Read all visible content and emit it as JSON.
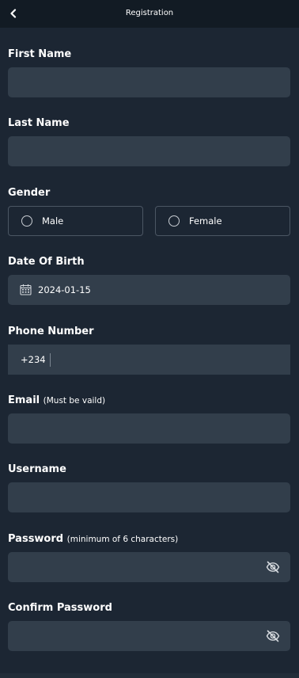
{
  "header": {
    "title": "Registration",
    "back_icon": "chevron-left-icon"
  },
  "form": {
    "first_name": {
      "label": "First Name",
      "value": "",
      "placeholder": ""
    },
    "last_name": {
      "label": "Last Name",
      "value": "",
      "placeholder": ""
    },
    "gender": {
      "label": "Gender",
      "options": [
        {
          "label": "Male",
          "selected": false
        },
        {
          "label": "Female",
          "selected": false
        }
      ]
    },
    "dob": {
      "label": "Date Of Birth",
      "value": "2024-01-15",
      "icon": "calendar-icon"
    },
    "phone": {
      "label": "Phone Number",
      "prefix": "+234",
      "value": ""
    },
    "email": {
      "label": "Email",
      "hint": "(Must be vaild)",
      "value": ""
    },
    "username": {
      "label": "Username",
      "value": ""
    },
    "password": {
      "label": "Password",
      "hint": "(minimum of 6 characters)",
      "value": "",
      "icon": "eye-off-icon"
    },
    "confirm_password": {
      "label": "Confirm Password",
      "value": "",
      "icon": "eye-off-icon"
    }
  },
  "colors": {
    "background": "#1c2633",
    "header": "#121b24",
    "field": "#323e4b",
    "radio_border": "#4b5663"
  }
}
